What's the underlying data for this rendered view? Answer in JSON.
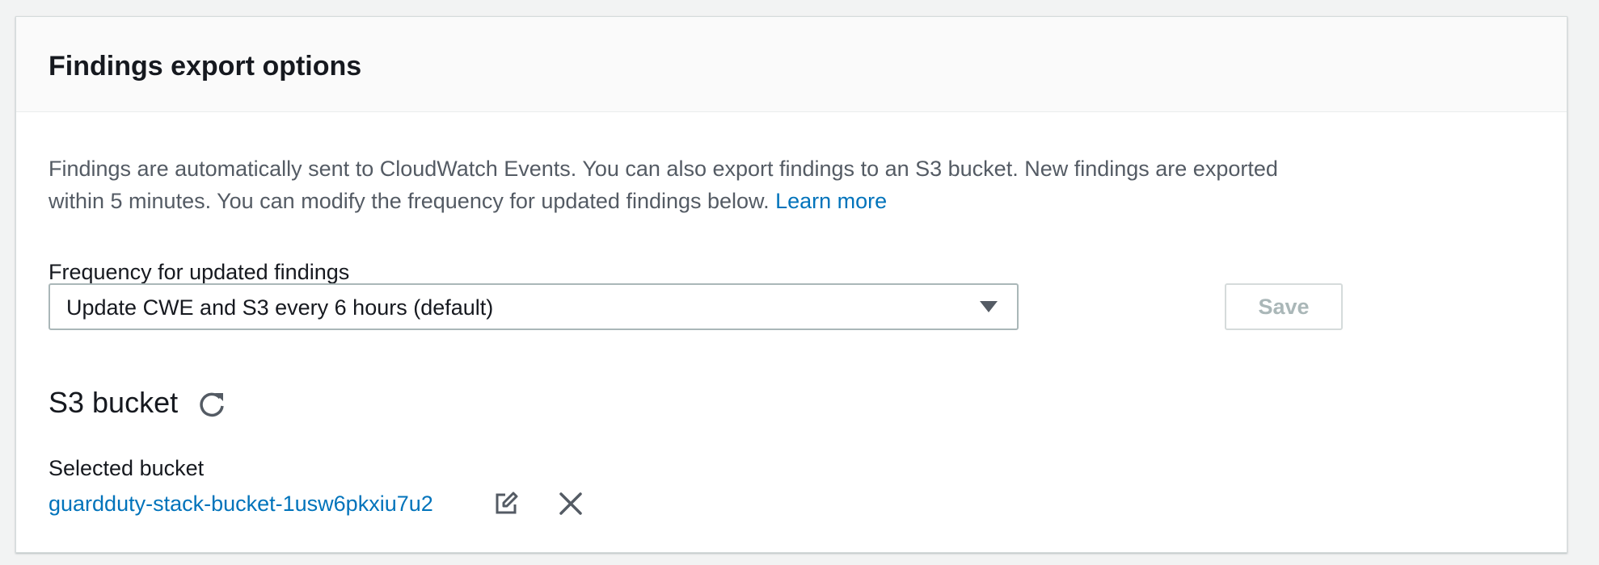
{
  "panel": {
    "title": "Findings export options"
  },
  "description": {
    "text": "Findings are automatically sent to CloudWatch Events. You can also export findings to an S3 bucket. New findings are exported within 5 minutes. You can modify the frequency for updated findings below. ",
    "learn_more": "Learn more"
  },
  "frequency": {
    "label": "Frequency for updated findings",
    "selected": "Update CWE and S3 every 6 hours (default)",
    "save_label": "Save"
  },
  "s3": {
    "section_title": "S3 bucket",
    "selected_label": "Selected bucket",
    "bucket_name": "guardduty-stack-bucket-1usw6pkxiu7u2"
  },
  "icons": {
    "refresh": "refresh-icon",
    "edit": "edit-icon",
    "remove": "close-icon",
    "dropdown": "caret-down-icon"
  },
  "colors": {
    "link": "#0073bb",
    "text": "#16191f",
    "muted": "#545b64",
    "disabled": "#aab7b8"
  }
}
